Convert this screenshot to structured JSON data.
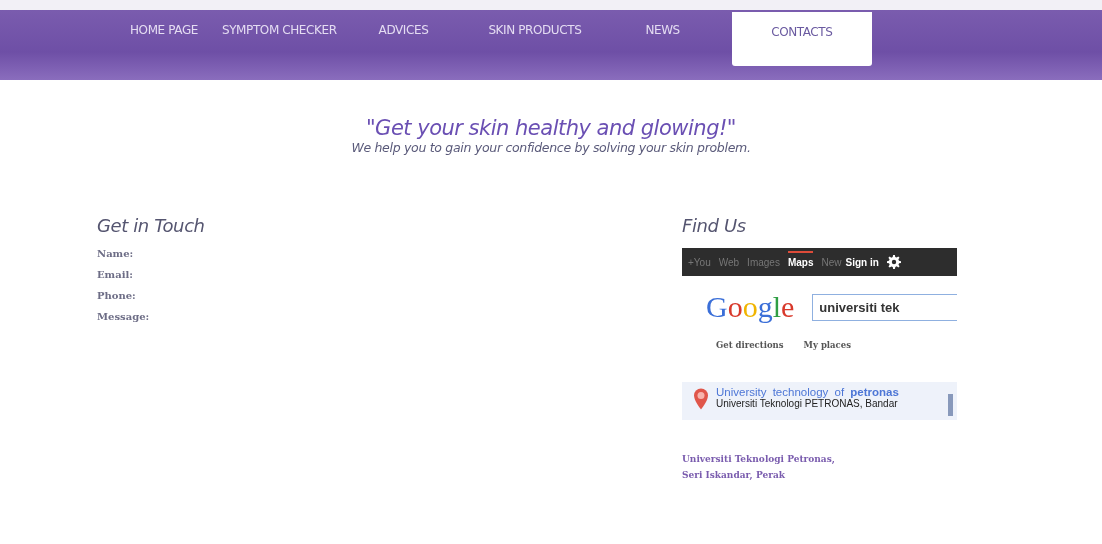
{
  "nav": [
    {
      "label": "HOME PAGE",
      "selected": false
    },
    {
      "label": "SYMPTOM CHECKER",
      "selected": false
    },
    {
      "label": "ADVICES",
      "selected": false
    },
    {
      "label": "SKIN PRODUCTS",
      "selected": false
    },
    {
      "label": "NEWS",
      "selected": false
    },
    {
      "label": "CONTACTS",
      "selected": true
    }
  ],
  "hero": {
    "quote": "\"Get your skin healthy and glowing!\"",
    "subtitle": "We help you to gain your confidence by solving your skin problem."
  },
  "contact_form": {
    "title": "Get in Touch",
    "fields": [
      "Name:",
      "Email:",
      "Phone:",
      "Message:"
    ]
  },
  "find_us": {
    "title": "Find Us",
    "map": {
      "bar_links": [
        {
          "label": "+You",
          "selected": false
        },
        {
          "label": "Web",
          "selected": false
        },
        {
          "label": "Images",
          "selected": false
        },
        {
          "label": "Maps",
          "selected": true
        },
        {
          "label": "New",
          "selected": false
        }
      ],
      "sign_in": "Sign in",
      "logo": "Google",
      "search_value": "universiti tek",
      "links": [
        "Get directions",
        "My places"
      ],
      "result_title": "University technology of **petronas**",
      "result_address": "Universiti Teknologi PETRONAS, Bandar"
    },
    "address": [
      "Universiti Teknologi Petronas,",
      "Seri Iskandar, Perak"
    ]
  }
}
